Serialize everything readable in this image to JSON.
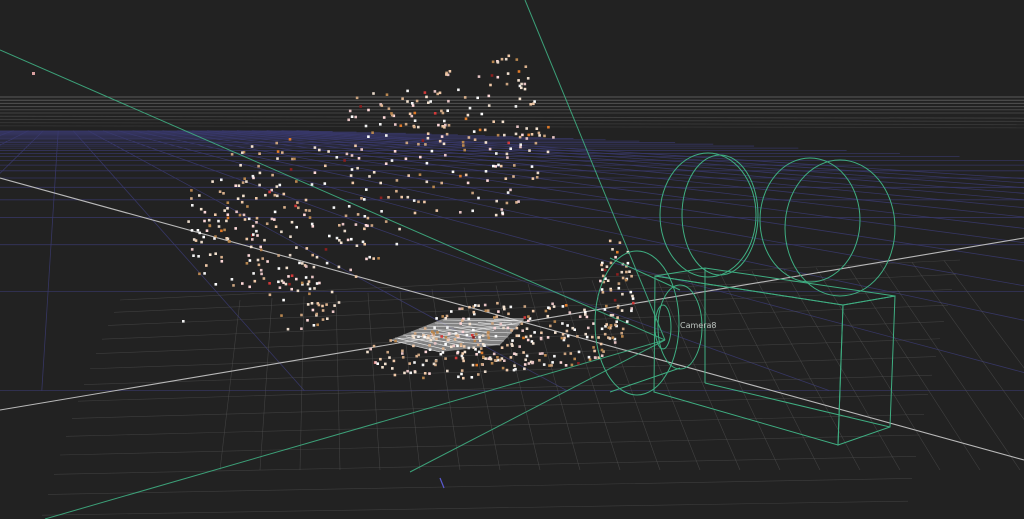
{
  "viewport": {
    "background_color": "#222222",
    "grid_color": "#3a3a6e",
    "horizon_color": "#8a8a8a",
    "axis_color": "#b9b9b9",
    "camera_color": "#3fae82"
  },
  "camera": {
    "label": "Camera8",
    "icon": "movie-camera-icon"
  }
}
